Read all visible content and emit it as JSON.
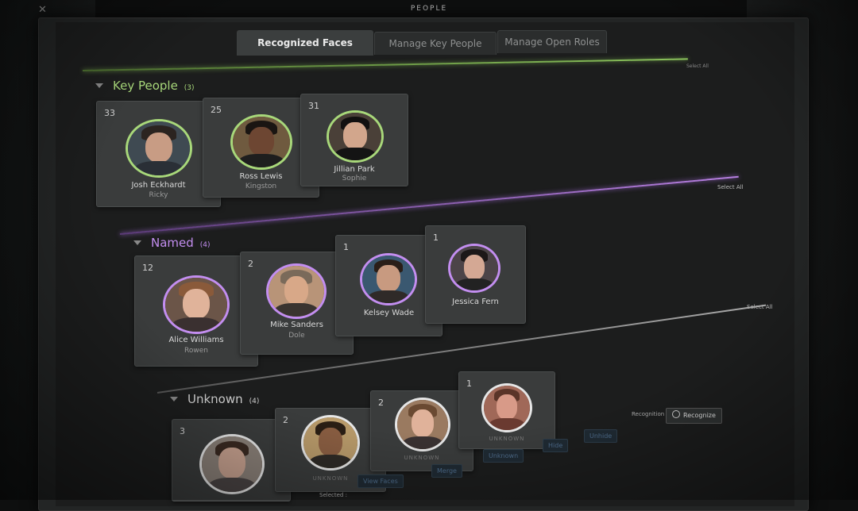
{
  "window": {
    "title": "PEOPLE",
    "close_label": "✕"
  },
  "tabs": [
    {
      "label": "Recognized Faces",
      "active": true
    },
    {
      "label": "Manage Key People",
      "active": false
    },
    {
      "label": "Manage Open Roles",
      "active": false
    }
  ],
  "top_select_all": "Select All",
  "sections": {
    "key_people": {
      "title": "Key People",
      "count": "(3)",
      "color": "#a8d87a",
      "select_all": "Select All",
      "cards": [
        {
          "count": "33",
          "name": "Josh Eckhardt",
          "sub": "Ricky"
        },
        {
          "count": "25",
          "name": "Ross Lewis",
          "sub": "Kingston"
        },
        {
          "count": "31",
          "name": "Jillian Park",
          "sub": "Sophie"
        }
      ]
    },
    "named": {
      "title": "Named",
      "count": "(4)",
      "color": "#c38ef0",
      "select_all": "Select All",
      "cards": [
        {
          "count": "12",
          "name": "Alice Williams",
          "sub": "Rowen"
        },
        {
          "count": "2",
          "name": "Mike Sanders",
          "sub": "Dole"
        },
        {
          "count": "1",
          "name": "Kelsey Wade",
          "sub": ""
        },
        {
          "count": "1",
          "name": "Jessica Fern",
          "sub": ""
        }
      ]
    },
    "unknown": {
      "title": "Unknown",
      "count": "(4)",
      "color": "#d0d0d0",
      "cards": [
        {
          "count": "3",
          "name": "",
          "sub": ""
        },
        {
          "count": "2",
          "name": "UNKNOWN",
          "sub": ""
        },
        {
          "count": "2",
          "name": "UNKNOWN",
          "sub": ""
        },
        {
          "count": "1",
          "name": "UNKNOWN",
          "sub": ""
        }
      ]
    }
  },
  "bottom_bar": {
    "selected_label": "Selected :",
    "view_faces": "View Faces",
    "merge": "Merge",
    "unknown": "Unknown",
    "hide": "Hide",
    "unhide": "Unhide"
  },
  "recognition": {
    "label": "Recognition :",
    "button": "Recognize"
  }
}
